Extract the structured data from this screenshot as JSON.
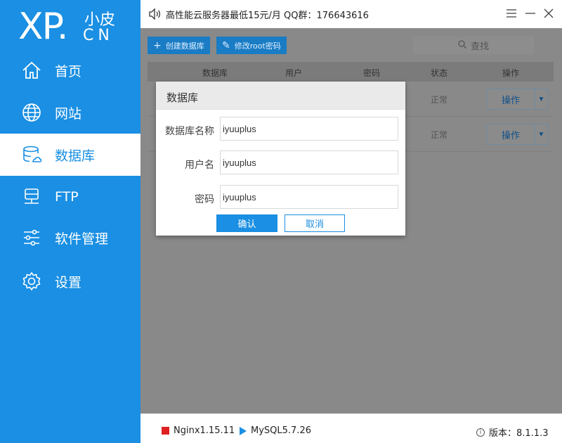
{
  "logo": {
    "main": "XP.",
    "top": "小皮",
    "bottom": "CN"
  },
  "nav": [
    {
      "label": "首页",
      "icon": "home-icon"
    },
    {
      "label": "网站",
      "icon": "globe-icon"
    },
    {
      "label": "数据库",
      "icon": "database-icon",
      "active": true
    },
    {
      "label": "FTP",
      "icon": "server-icon"
    },
    {
      "label": "软件管理",
      "icon": "sliders-icon"
    },
    {
      "label": "设置",
      "icon": "gear-icon"
    }
  ],
  "topbar": {
    "notice": "高性能云服务器最低15元/月  QQ群：176643616"
  },
  "toolbar": {
    "create_label": "创建数据库",
    "change_root_label": "修改root密码",
    "search_label": "查找"
  },
  "table": {
    "headers": [
      "数据库",
      "用户",
      "密码",
      "状态",
      "操作"
    ],
    "rows": [
      {
        "status": "正常",
        "action": "操作"
      },
      {
        "status": "正常",
        "action": "操作"
      }
    ]
  },
  "dialog": {
    "title": "数据库",
    "fields": [
      {
        "label": "数据库名称",
        "value": "iyuuplus"
      },
      {
        "label": "用户名",
        "value": "iyuuplus"
      },
      {
        "label": "密码",
        "value": "iyuuplus"
      }
    ],
    "ok_label": "确认",
    "cancel_label": "取消"
  },
  "statusbar": {
    "nginx": "Nginx1.15.11",
    "mysql": "MySQL5.7.26",
    "version": "版本：8.1.1.3"
  },
  "colors": {
    "accent": "#1a8fe3",
    "running": "#1a8fe3",
    "stopped": "#e02020"
  }
}
